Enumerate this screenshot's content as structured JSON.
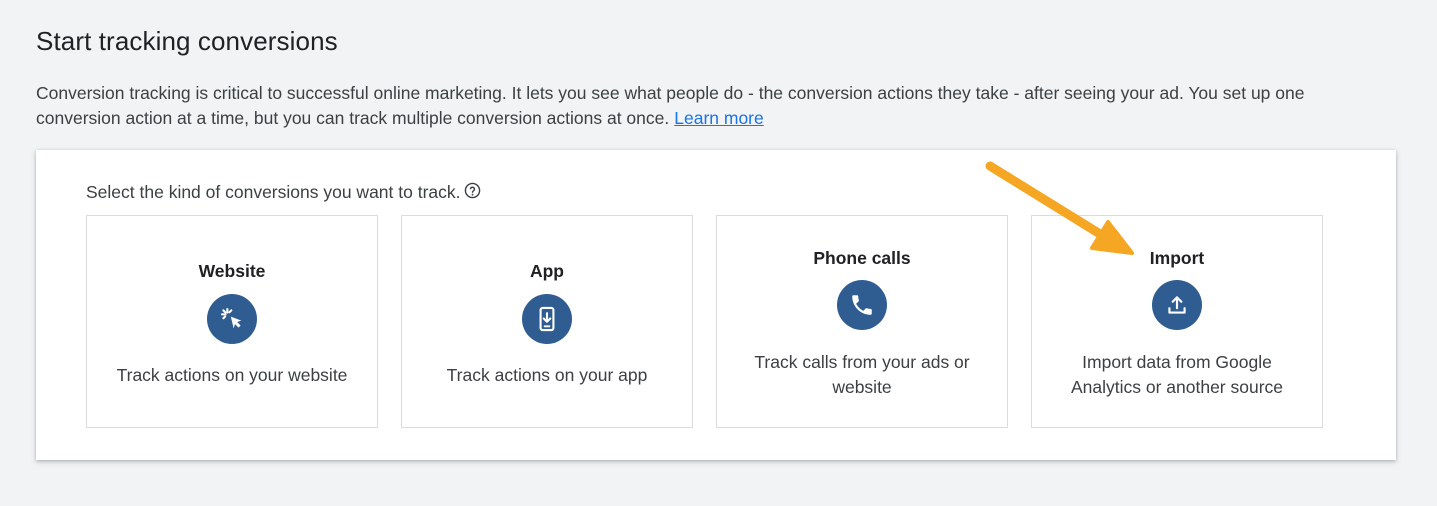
{
  "header": {
    "title": "Start tracking conversions",
    "description": "Conversion tracking is critical to successful online marketing. It lets you see what people do - the conversion actions they take - after seeing your ad. You set up one conversion action at a time, but you can track multiple conversion actions at once.",
    "learn_more": "Learn more"
  },
  "panel": {
    "prompt": "Select the kind of conversions you want to track.",
    "cards": [
      {
        "title": "Website",
        "description": "Track actions on your website",
        "icon": "cursor-click-icon"
      },
      {
        "title": "App",
        "description": "Track actions on your app",
        "icon": "phone-download-icon"
      },
      {
        "title": "Phone calls",
        "description": "Track calls from your ads or website",
        "icon": "phone-icon"
      },
      {
        "title": "Import",
        "description": "Import data from Google Analytics or another source",
        "icon": "upload-icon"
      }
    ]
  },
  "colors": {
    "icon_circle": "#2f5d91",
    "link": "#1a73e8",
    "annotation_arrow": "#f5a623"
  }
}
